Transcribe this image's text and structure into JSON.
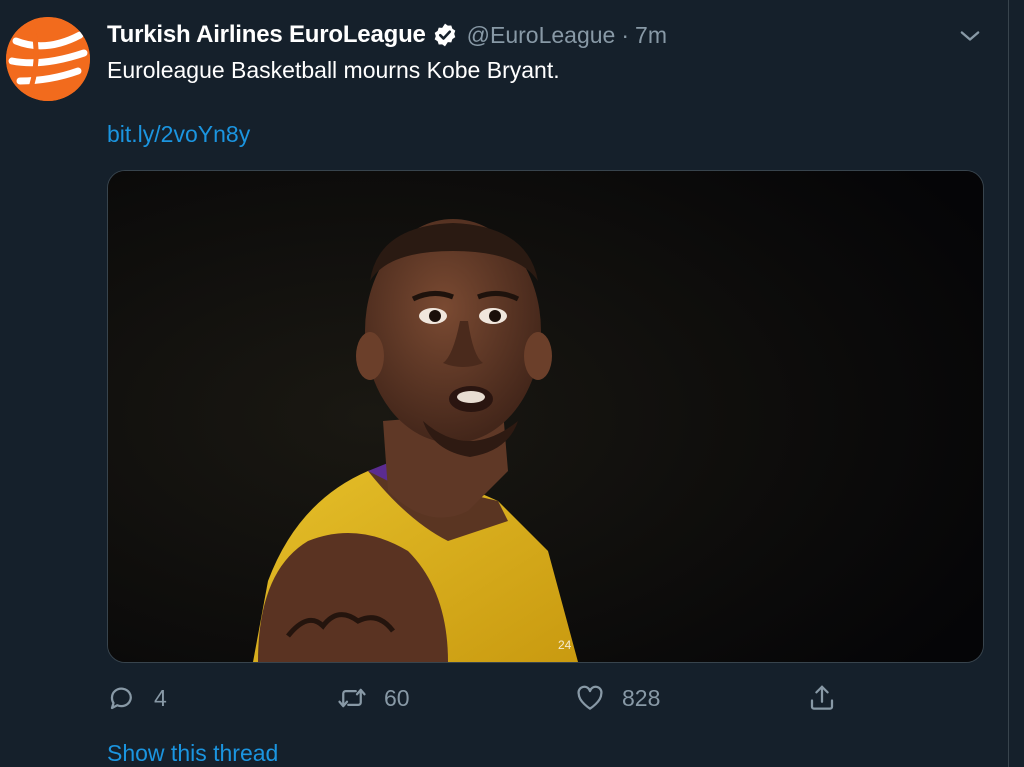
{
  "tweet": {
    "display_name": "Turkish Airlines EuroLeague",
    "handle": "@EuroLeague",
    "separator": "·",
    "time": "7m",
    "text": "Euroleague Basketball mourns Kobe Bryant.",
    "link": "bit.ly/2voYn8y",
    "show_thread": "Show this thread"
  },
  "actions": {
    "reply_count": "4",
    "retweet_count": "60",
    "like_count": "828"
  },
  "icons": {
    "avatar": "euroleague-logo-icon",
    "verified": "verified-badge-icon",
    "menu": "chevron-down-icon",
    "reply": "reply-icon",
    "retweet": "retweet-icon",
    "like": "heart-icon",
    "share": "share-icon"
  },
  "colors": {
    "background": "#15202b",
    "secondary_text": "#8899a6",
    "link": "#1b95e0",
    "brand_orange": "#f26b1d",
    "border": "#38444d"
  }
}
